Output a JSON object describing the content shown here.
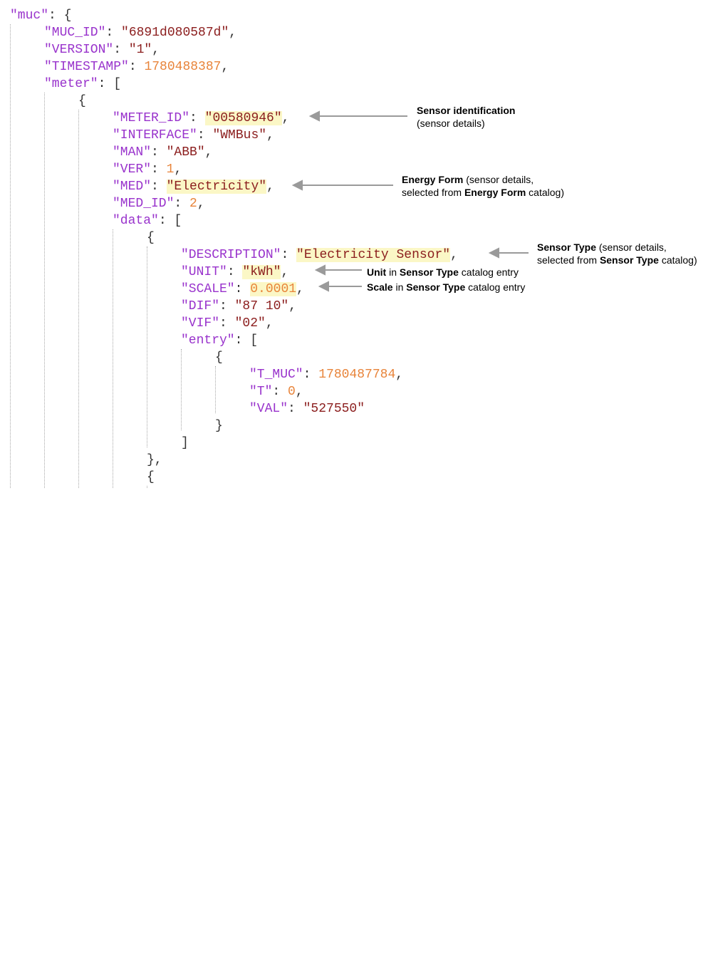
{
  "json": {
    "l1_key": "\"muc\"",
    "l1_rest": ": {",
    "l2_key": "\"MUC_ID\"",
    "l2_val": "\"6891d080587d\"",
    "l3_key": "\"VERSION\"",
    "l3_val": "\"1\"",
    "l4_key": "\"TIMESTAMP\"",
    "l4_val": "1780488387",
    "l5_key": "\"meter\"",
    "l5_rest": ": [",
    "l6": "{",
    "l7_key": "\"METER_ID\"",
    "l7_val": "\"00580946\"",
    "l8_key": "\"INTERFACE\"",
    "l8_val": "\"WMBus\"",
    "l9_key": "\"MAN\"",
    "l9_val": "\"ABB\"",
    "l10_key": "\"VER\"",
    "l10_val": "1",
    "l11_key": "\"MED\"",
    "l11_val": "\"Electricity\"",
    "l12_key": "\"MED_ID\"",
    "l12_val": "2",
    "l13_key": "\"data\"",
    "l13_rest": ": [",
    "l14": "{",
    "l15_key": "\"DESCRIPTION\"",
    "l15_val": "\"Electricity Sensor\"",
    "l16_key": "\"UNIT\"",
    "l16_val": "\"kWh\"",
    "l17_key": "\"SCALE\"",
    "l17_val": "0.0001",
    "l18_key": "\"DIF\"",
    "l18_val": "\"87 10\"",
    "l19_key": "\"VIF\"",
    "l19_val": "\"02\"",
    "l20_key": "\"entry\"",
    "l20_rest": ": [",
    "l21": "{",
    "l22_key": "\"T_MUC\"",
    "l22_val": "1780487784",
    "l23_key": "\"T\"",
    "l23_val": "0",
    "l24_key": "\"VAL\"",
    "l24_val": "\"527550\"",
    "l25": "}",
    "l26": "]",
    "l27": "},",
    "l28": "{"
  },
  "annotations": {
    "sensor_id": {
      "title": "Sensor identification",
      "detail": "(sensor details)"
    },
    "energy_form": {
      "line1_bold": "Energy Form",
      "line1_rest": " (sensor details,",
      "line2_pre": "selected from ",
      "line2_bold": "Energy Form",
      "line2_post": " catalog)"
    },
    "sensor_type": {
      "line1_bold": "Sensor Type",
      "line1_rest": " (sensor details,",
      "line2_pre": "selected from ",
      "line2_bold": "Sensor Type",
      "line2_post": " catalog)"
    },
    "unit": {
      "bold1": "Unit",
      "mid": " in ",
      "bold2": "Sensor Type",
      "post": " catalog entry"
    },
    "scale": {
      "bold1": "Scale",
      "mid": " in ",
      "bold2": "Sensor Type",
      "post": " catalog entry"
    }
  },
  "colors": {
    "key": "#9933cc",
    "string": "#8b1d1d",
    "number": "#e8843a",
    "highlight": "#fbf7c6",
    "arrow": "#9a9a9a"
  }
}
